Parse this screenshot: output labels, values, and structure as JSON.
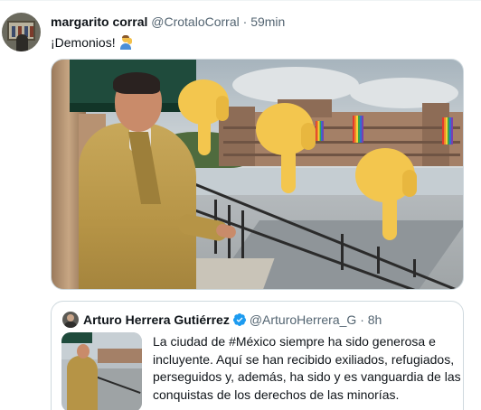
{
  "tweet": {
    "display_name": "margarito corral",
    "handle": "@CrotaloCorral",
    "separator": "·",
    "time": "59min",
    "text": "¡Demonios!",
    "emoji_icon": "person-facepalming-emoji"
  },
  "photo": {
    "overlay_icon": "pointing-down-hand-emoji",
    "overlay_count": 3
  },
  "quoted_tweet": {
    "display_name": "Arturo Herrera Gutiérrez",
    "verified_icon": "verified-badge-icon",
    "handle": "@ArturoHerrera_G",
    "separator": "·",
    "time": "8h",
    "text_lines": [
      "La ciudad de #México siempre ha sido generosa e",
      "incluyente. Aquí se han recibido exiliados, refugiados,",
      "perseguidos y, además, ha sido y es vanguardia de las",
      "conquistas de los derechos de las minorías.",
      "..."
    ]
  },
  "colors": {
    "text_primary": "#0f1419",
    "text_secondary": "#536471",
    "border": "#cfd9de",
    "verified_blue": "#1d9bf0"
  }
}
